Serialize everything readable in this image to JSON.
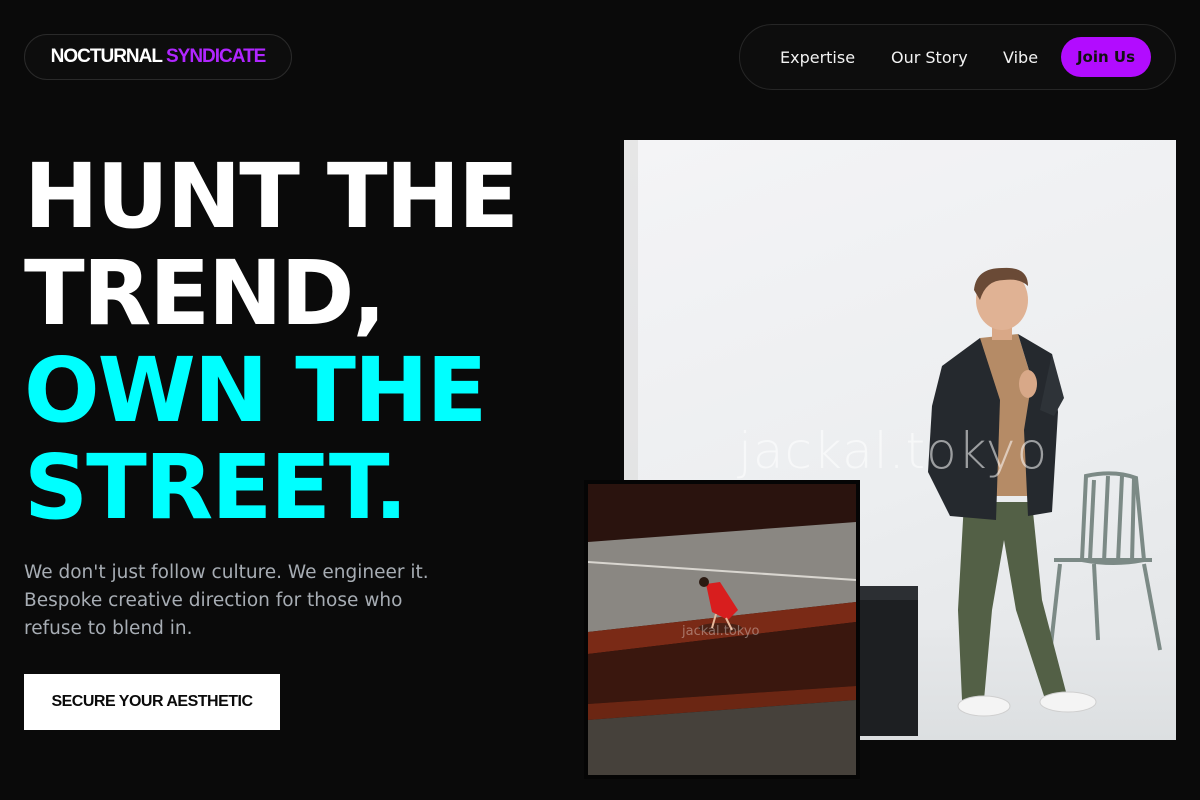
{
  "brand": {
    "word1": "NOCTURNAL",
    "word2": "SYNDICATE",
    "accent_color": "#b026ff"
  },
  "nav": {
    "links": [
      "Expertise",
      "Our Story",
      "Vibe"
    ],
    "join_label": "Join Us",
    "join_color": "#b20cff"
  },
  "hero": {
    "headline_white": [
      "HUNT THE",
      "TREND,"
    ],
    "headline_cyan": [
      "OWN THE",
      "STREET."
    ],
    "headline_accent_color": "#00ffff",
    "subtitle": "We don't just follow culture. We engineer it. Bespoke creative direction for those who refuse to blend in.",
    "cta_label": "SECURE YOUR AESTHETIC"
  },
  "gallery": {
    "main_watermark": "jackal.tokyo",
    "small_watermark": "jackal.tokyo"
  }
}
